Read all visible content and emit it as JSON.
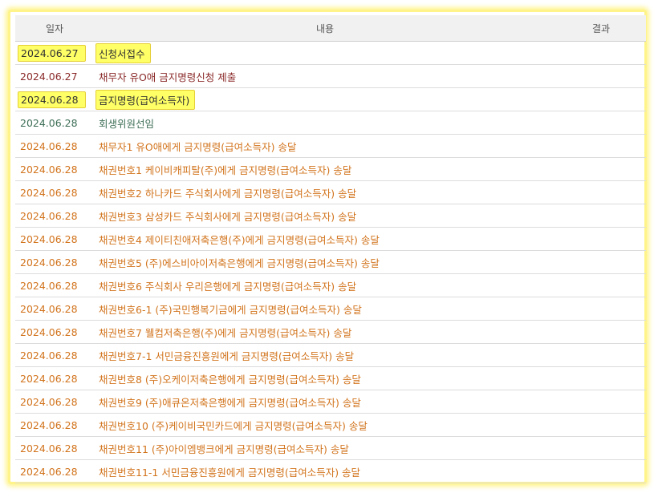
{
  "table": {
    "headers": {
      "date": "일자",
      "content": "내용",
      "result": "결과"
    },
    "rows": [
      {
        "date": "2024.06.27",
        "content": "신청서접수",
        "result": ""
      },
      {
        "date": "2024.06.27",
        "content": "채무자 유O애 금지명령신청 제출",
        "result": ""
      },
      {
        "date": "2024.06.28",
        "content": "금지명령(급여소득자)",
        "result": ""
      },
      {
        "date": "2024.06.28",
        "content": "회생위원선임",
        "result": ""
      },
      {
        "date": "2024.06.28",
        "content": "채무자1 유O애에게 금지명령(급여소득자) 송달",
        "result": ""
      },
      {
        "date": "2024.06.28",
        "content": "채권번호1 케이비캐피탈(주)에게 금지명령(급여소득자) 송달",
        "result": ""
      },
      {
        "date": "2024.06.28",
        "content": "채권번호2 하나카드 주식회사에게 금지명령(급여소득자) 송달",
        "result": ""
      },
      {
        "date": "2024.06.28",
        "content": "채권번호3 삼성카드 주식회사에게 금지명령(급여소득자) 송달",
        "result": ""
      },
      {
        "date": "2024.06.28",
        "content": "채권번호4 제이티친애저축은행(주)에게 금지명령(급여소득자) 송달",
        "result": ""
      },
      {
        "date": "2024.06.28",
        "content": "채권번호5 (주)에스비아이저축은행에게 금지명령(급여소득자) 송달",
        "result": ""
      },
      {
        "date": "2024.06.28",
        "content": "채권번호6 주식회사 우리은행에게 금지명령(급여소득자) 송달",
        "result": ""
      },
      {
        "date": "2024.06.28",
        "content": "채권번호6-1 (주)국민행복기금에게 금지명령(급여소득자) 송달",
        "result": ""
      },
      {
        "date": "2024.06.28",
        "content": "채권번호7 웰컴저축은행(주)에게 금지명령(급여소득자) 송달",
        "result": ""
      },
      {
        "date": "2024.06.28",
        "content": "채권번호7-1 서민금융진흥원에게 금지명령(급여소득자) 송달",
        "result": ""
      },
      {
        "date": "2024.06.28",
        "content": "채권번호8 (주)오케이저축은행에게 금지명령(급여소득자) 송달",
        "result": ""
      },
      {
        "date": "2024.06.28",
        "content": "채권번호9 (주)애큐온저축은행에게 금지명령(급여소득자) 송달",
        "result": ""
      },
      {
        "date": "2024.06.28",
        "content": "채권번호10 (주)케이비국민카드에게 금지명령(급여소득자) 송달",
        "result": ""
      },
      {
        "date": "2024.06.28",
        "content": "채권번호11 (주)아이엠뱅크에게 금지명령(급여소득자) 송달",
        "result": ""
      },
      {
        "date": "2024.06.28",
        "content": "채권번호11-1 서민금융진흥원에게 금지명령(급여소득자) 송달",
        "result": ""
      }
    ]
  },
  "colors": {
    "highlight": "#ffff66",
    "black": "#333333",
    "maroon": "#8b2a2a",
    "green": "#3d6e56",
    "orange": "#d2741d"
  }
}
